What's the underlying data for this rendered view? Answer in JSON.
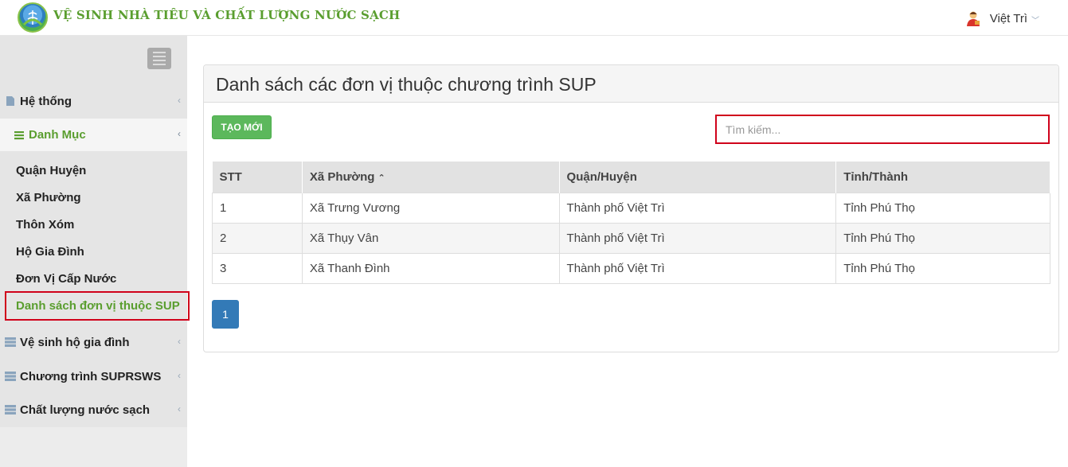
{
  "header": {
    "title": "VỆ SINH NHÀ TIÊU VÀ CHẤT LƯỢNG NƯỚC SẠCH",
    "user_name": "Việt Trì",
    "user_caret": "﹀"
  },
  "sidebar": {
    "groups": [
      {
        "label": "Hệ thống",
        "icon": "file-icon",
        "chevron": "‹"
      },
      {
        "label": "Danh Mục",
        "icon": "list-icon",
        "chevron": "‹"
      },
      {
        "label": "Vệ sinh hộ gia đình",
        "icon": "server-icon",
        "chevron": "‹"
      },
      {
        "label": "Chương trình SUPRSWS",
        "icon": "server-icon",
        "chevron": "‹"
      },
      {
        "label": "Chất lượng nước sạch",
        "icon": "server-icon",
        "chevron": "‹"
      }
    ],
    "sub_items": [
      {
        "label": "Quận Huyện"
      },
      {
        "label": "Xã Phường"
      },
      {
        "label": "Thôn Xóm"
      },
      {
        "label": "Hộ Gia Đình"
      },
      {
        "label": "Đơn Vị Cấp Nước"
      },
      {
        "label": "Danh sách đơn vị thuộc SUP"
      }
    ]
  },
  "main": {
    "title": "Danh sách các đơn vị thuộc chương trình SUP",
    "create_label": "TẠO MỚI",
    "search_placeholder": "Tìm kiếm...",
    "table": {
      "headers": [
        "STT",
        "Xã Phường",
        "Quận/Huyện",
        "Tỉnh/Thành"
      ],
      "sort_indicator": "⌃",
      "rows": [
        [
          "1",
          "Xã Trưng Vương",
          "Thành phố Việt Trì",
          "Tỉnh Phú Thọ"
        ],
        [
          "2",
          "Xã Thụy Vân",
          "Thành phố Việt Trì",
          "Tỉnh Phú Thọ"
        ],
        [
          "3",
          "Xã Thanh Đình",
          "Thành phố Việt Trì",
          "Tỉnh Phú Thọ"
        ]
      ]
    },
    "pagination": {
      "current": "1"
    }
  },
  "colors": {
    "brand_green": "#5a9e2f",
    "button_green": "#5cb85c",
    "page_blue": "#337ab7",
    "highlight_red": "#d0021b"
  }
}
